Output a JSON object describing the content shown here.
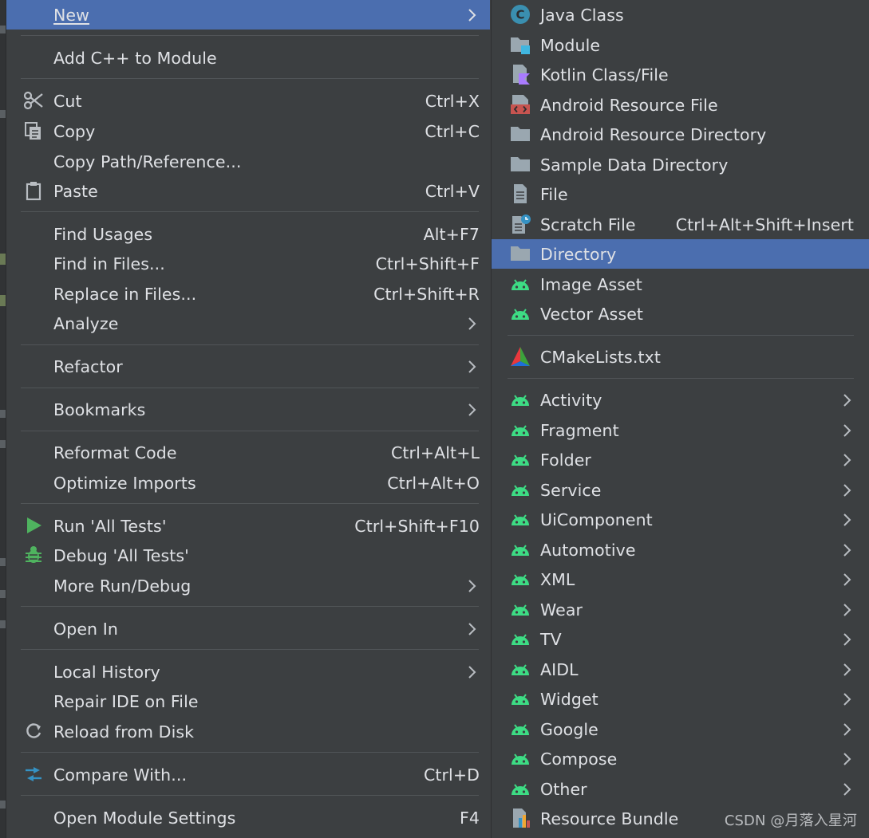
{
  "main_menu": {
    "new": {
      "label": "New"
    },
    "add_cpp": {
      "label": "Add C++ to Module"
    },
    "cut": {
      "label": "Cut",
      "shortcut": "Ctrl+X"
    },
    "copy": {
      "label": "Copy",
      "shortcut": "Ctrl+C"
    },
    "copy_path": {
      "label": "Copy Path/Reference..."
    },
    "paste": {
      "label": "Paste",
      "shortcut": "Ctrl+V"
    },
    "find_usages": {
      "label": "Find Usages",
      "shortcut": "Alt+F7"
    },
    "find_in_files": {
      "label": "Find in Files...",
      "shortcut": "Ctrl+Shift+F"
    },
    "replace_in_files": {
      "label": "Replace in Files...",
      "shortcut": "Ctrl+Shift+R"
    },
    "analyze": {
      "label": "Analyze"
    },
    "refactor": {
      "label": "Refactor"
    },
    "bookmarks": {
      "label": "Bookmarks"
    },
    "reformat_code": {
      "label": "Reformat Code",
      "shortcut": "Ctrl+Alt+L"
    },
    "optimize_imports": {
      "label": "Optimize Imports",
      "shortcut": "Ctrl+Alt+O"
    },
    "run_tests": {
      "label": "Run 'All Tests'",
      "shortcut": "Ctrl+Shift+F10"
    },
    "debug_tests": {
      "label": "Debug 'All Tests'"
    },
    "more_run_debug": {
      "label": "More Run/Debug"
    },
    "open_in": {
      "label": "Open In"
    },
    "local_history": {
      "label": "Local History"
    },
    "repair_ide": {
      "label": "Repair IDE on File"
    },
    "reload_disk": {
      "label": "Reload from Disk"
    },
    "compare_with": {
      "label": "Compare With...",
      "shortcut": "Ctrl+D"
    },
    "module_settings": {
      "label": "Open Module Settings",
      "shortcut": "F4"
    }
  },
  "sub_menu": {
    "java_class": {
      "label": "Java Class"
    },
    "module": {
      "label": "Module"
    },
    "kotlin_class": {
      "label": "Kotlin Class/File"
    },
    "android_resource_file": {
      "label": "Android Resource File"
    },
    "android_resource_directory": {
      "label": "Android Resource Directory"
    },
    "sample_data_directory": {
      "label": "Sample Data Directory"
    },
    "file": {
      "label": "File"
    },
    "scratch_file": {
      "label": "Scratch File",
      "shortcut": "Ctrl+Alt+Shift+Insert"
    },
    "directory": {
      "label": "Directory"
    },
    "image_asset": {
      "label": "Image Asset"
    },
    "vector_asset": {
      "label": "Vector Asset"
    },
    "cmakelists": {
      "label": "CMakeLists.txt"
    },
    "activity": {
      "label": "Activity"
    },
    "fragment": {
      "label": "Fragment"
    },
    "folder": {
      "label": "Folder"
    },
    "service": {
      "label": "Service"
    },
    "uicomponent": {
      "label": "UiComponent"
    },
    "automotive": {
      "label": "Automotive"
    },
    "xml": {
      "label": "XML"
    },
    "wear": {
      "label": "Wear"
    },
    "tv": {
      "label": "TV"
    },
    "aidl": {
      "label": "AIDL"
    },
    "widget": {
      "label": "Widget"
    },
    "google": {
      "label": "Google"
    },
    "compose": {
      "label": "Compose"
    },
    "other": {
      "label": "Other"
    },
    "resource_bundle": {
      "label": "Resource Bundle"
    }
  },
  "watermark": "CSDN @月落入星河",
  "colors": {
    "menu_bg": "#3c3f41",
    "highlight": "#4b6eaf",
    "text": "#dfe1e5",
    "separator": "#515558",
    "android_green": "#3ddc84",
    "folder_gray": "#9aa7b0",
    "run_green": "#4fb35f"
  },
  "icons": {
    "cut": "scissors-icon",
    "copy": "copy-icon",
    "paste": "paste-icon",
    "run": "run-triangle-icon",
    "debug": "debug-bug-icon",
    "reload": "reload-icon",
    "compare": "compare-arrows-icon",
    "java_class": "java-class-icon",
    "module": "module-folder-icon",
    "kotlin": "kotlin-file-icon",
    "android_resource_file": "android-resource-file-icon",
    "folder": "folder-icon",
    "file": "file-icon",
    "scratch": "scratch-file-icon",
    "android": "android-icon",
    "cmake": "cmake-icon",
    "resource_bundle": "resource-bundle-icon",
    "submenu": "chevron-right-icon"
  }
}
